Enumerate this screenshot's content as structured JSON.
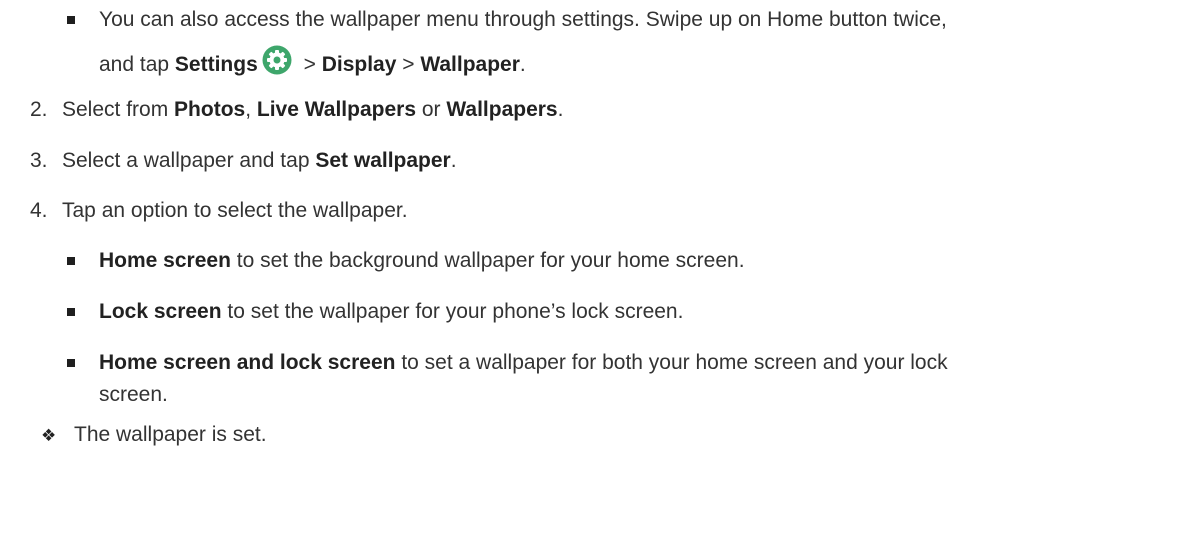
{
  "intro_bullet": {
    "line1": "You can also access the wallpaper menu through settings. Swipe up on Home button twice,",
    "line2_prefix": "and tap ",
    "settings": "Settings",
    "sep1": " > ",
    "display": "Display",
    "sep2": " > ",
    "wallpaper": "Wallpaper",
    "end": "."
  },
  "steps": [
    {
      "number": "2.",
      "prefix": "Select from ",
      "photos": "Photos",
      "comma": ", ",
      "live": "Live Wallpapers",
      "or": " or ",
      "wallpapers": "Wallpapers",
      "end": "."
    },
    {
      "number": "3.",
      "prefix": "Select a wallpaper and tap ",
      "bold": "Set wallpaper",
      "end": "."
    },
    {
      "number": "4.",
      "text": "Tap an option to select the wallpaper."
    }
  ],
  "options": [
    {
      "bold": "Home screen",
      "rest": " to set the background wallpaper for your home screen."
    },
    {
      "bold": "Lock screen",
      "rest": " to set the wallpaper for your phone’s lock screen."
    },
    {
      "bold": "Home screen and lock screen",
      "rest": " to set a wallpaper for both your home screen and your lock",
      "rest_line2": "screen."
    }
  ],
  "result": {
    "symbol": "❖",
    "text": "The wallpaper is set."
  },
  "icons": {
    "settings": "settings-gear-icon"
  },
  "colors": {
    "settings_icon": "#3ea66b",
    "text": "#333333"
  }
}
